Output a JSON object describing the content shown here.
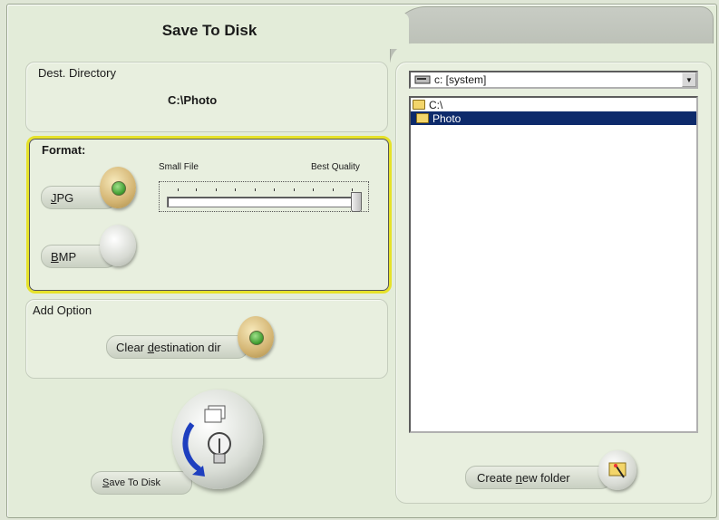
{
  "window": {
    "title": "Save To Disk"
  },
  "destination": {
    "label": "Dest. Directory",
    "path": "C:\\Photo"
  },
  "format": {
    "label": "Format:",
    "slider_min_label": "Small File",
    "slider_max_label": "Best Quality",
    "quality_level": 1.0,
    "options": [
      {
        "label": "JPG",
        "selected": true
      },
      {
        "label": "BMP",
        "selected": false
      }
    ]
  },
  "add_option": {
    "label": "Add Option",
    "clear_label": "Clear destination dir",
    "clear_checked": true
  },
  "save": {
    "label": "Save To Disk"
  },
  "drive": {
    "selected": "c: [system]"
  },
  "tree": {
    "items": [
      {
        "label": "C:\\",
        "selected": false
      },
      {
        "label": "Photo",
        "selected": true
      }
    ]
  },
  "create_folder": {
    "label": "Create new folder"
  },
  "colors": {
    "background": "#e3ecd9",
    "format_border": "#e6e22a",
    "selection": "#0d2a6b"
  },
  "icons": [
    "drive-icon",
    "folder-open-icon",
    "folder-icon",
    "dropdown-arrow-icon",
    "save-disk-icon",
    "new-folder-icon"
  ]
}
